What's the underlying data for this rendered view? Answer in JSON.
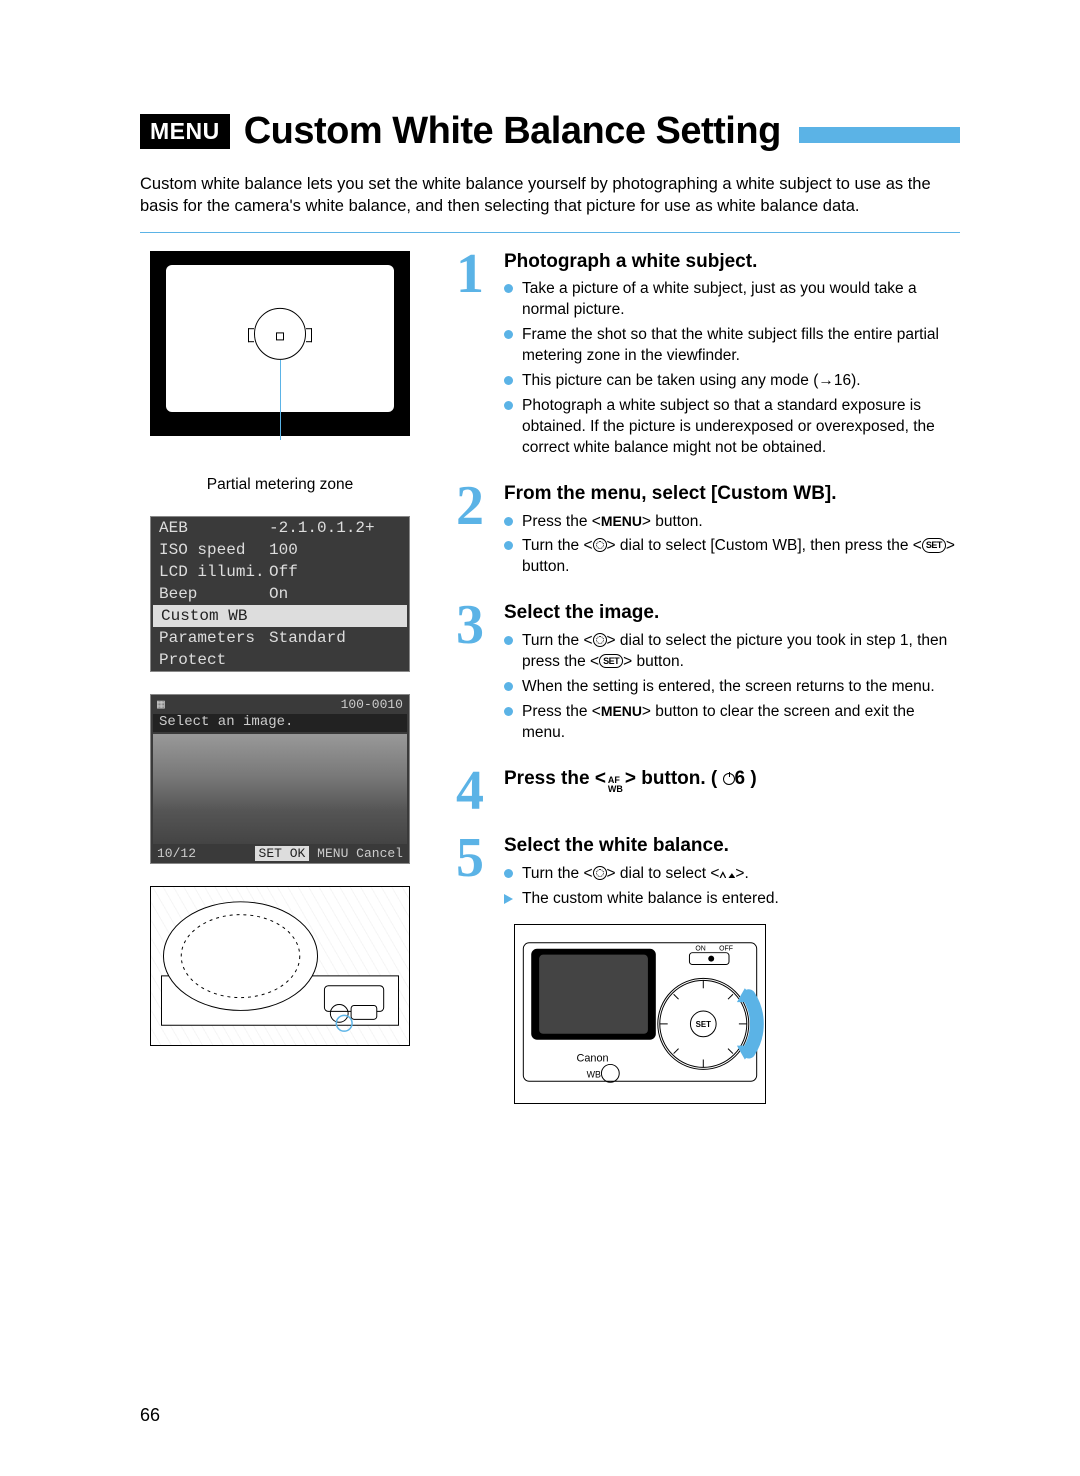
{
  "header": {
    "menu_badge": "MENU",
    "title": "Custom White Balance Setting"
  },
  "intro": "Custom white balance lets you set the white balance yourself by photographing a white subject to use as the basis for the camera's white balance, and then selecting that picture for use as white balance data.",
  "viewfinder_caption": "Partial metering zone",
  "lcd_menu_rows": [
    {
      "key": "AEB",
      "val": "-2.1.0.1.2+"
    },
    {
      "key": "ISO speed",
      "val": "100"
    },
    {
      "key": "LCD illumi.",
      "val": "Off"
    },
    {
      "key": "Beep",
      "val": "On"
    },
    {
      "key": "Custom WB",
      "val": "",
      "selected": true
    },
    {
      "key": "Parameters",
      "val": "Standard"
    },
    {
      "key": "Protect",
      "val": ""
    }
  ],
  "lcd_select": {
    "file_no": "100-0010",
    "prompt": "Select an image.",
    "counter": "10/12",
    "ok_label": "SET OK",
    "cancel_label": "MENU Cancel"
  },
  "steps": {
    "s1": {
      "num": "1",
      "title": "Photograph a white subject.",
      "items": [
        "Take a picture of a white subject, just as you would take a normal picture.",
        "Frame the shot so that the white subject fills the entire partial metering zone in the viewfinder.",
        "This picture can be taken using any mode (→16).",
        "Photograph a white subject so that a standard exposure is obtained. If the picture is underex­posed or overexposed, the correct white balance might not be obtained."
      ]
    },
    "s2": {
      "num": "2",
      "title": "From the menu, select [Custom WB].",
      "items_pre": [
        "Press the <",
        "> button."
      ],
      "items_b_parts": [
        "Turn the <",
        "> dial to select [Custom WB], then press the <",
        "> button."
      ]
    },
    "s3": {
      "num": "3",
      "title": "Select the image.",
      "item_a_parts": [
        "Turn the <",
        "> dial to select the picture you took in step 1, then press the <",
        "> button."
      ],
      "item_b": "When the setting is entered, the screen returns to the menu.",
      "item_c_parts": [
        "Press the <",
        "> button to clear the screen and exit the menu."
      ]
    },
    "s4": {
      "num": "4",
      "title_parts": [
        "Press the <",
        "> button. (",
        "6 )"
      ],
      "afwb_top": "AF",
      "afwb_bot": "WB"
    },
    "s5": {
      "num": "5",
      "title": "Select the white balance.",
      "item_a_parts": [
        "Turn the <",
        "> dial to select <",
        ">."
      ],
      "item_b": "The custom white balance is entered."
    }
  },
  "inline_labels": {
    "menu": "MENU",
    "set": "SET"
  },
  "page_number": "66"
}
